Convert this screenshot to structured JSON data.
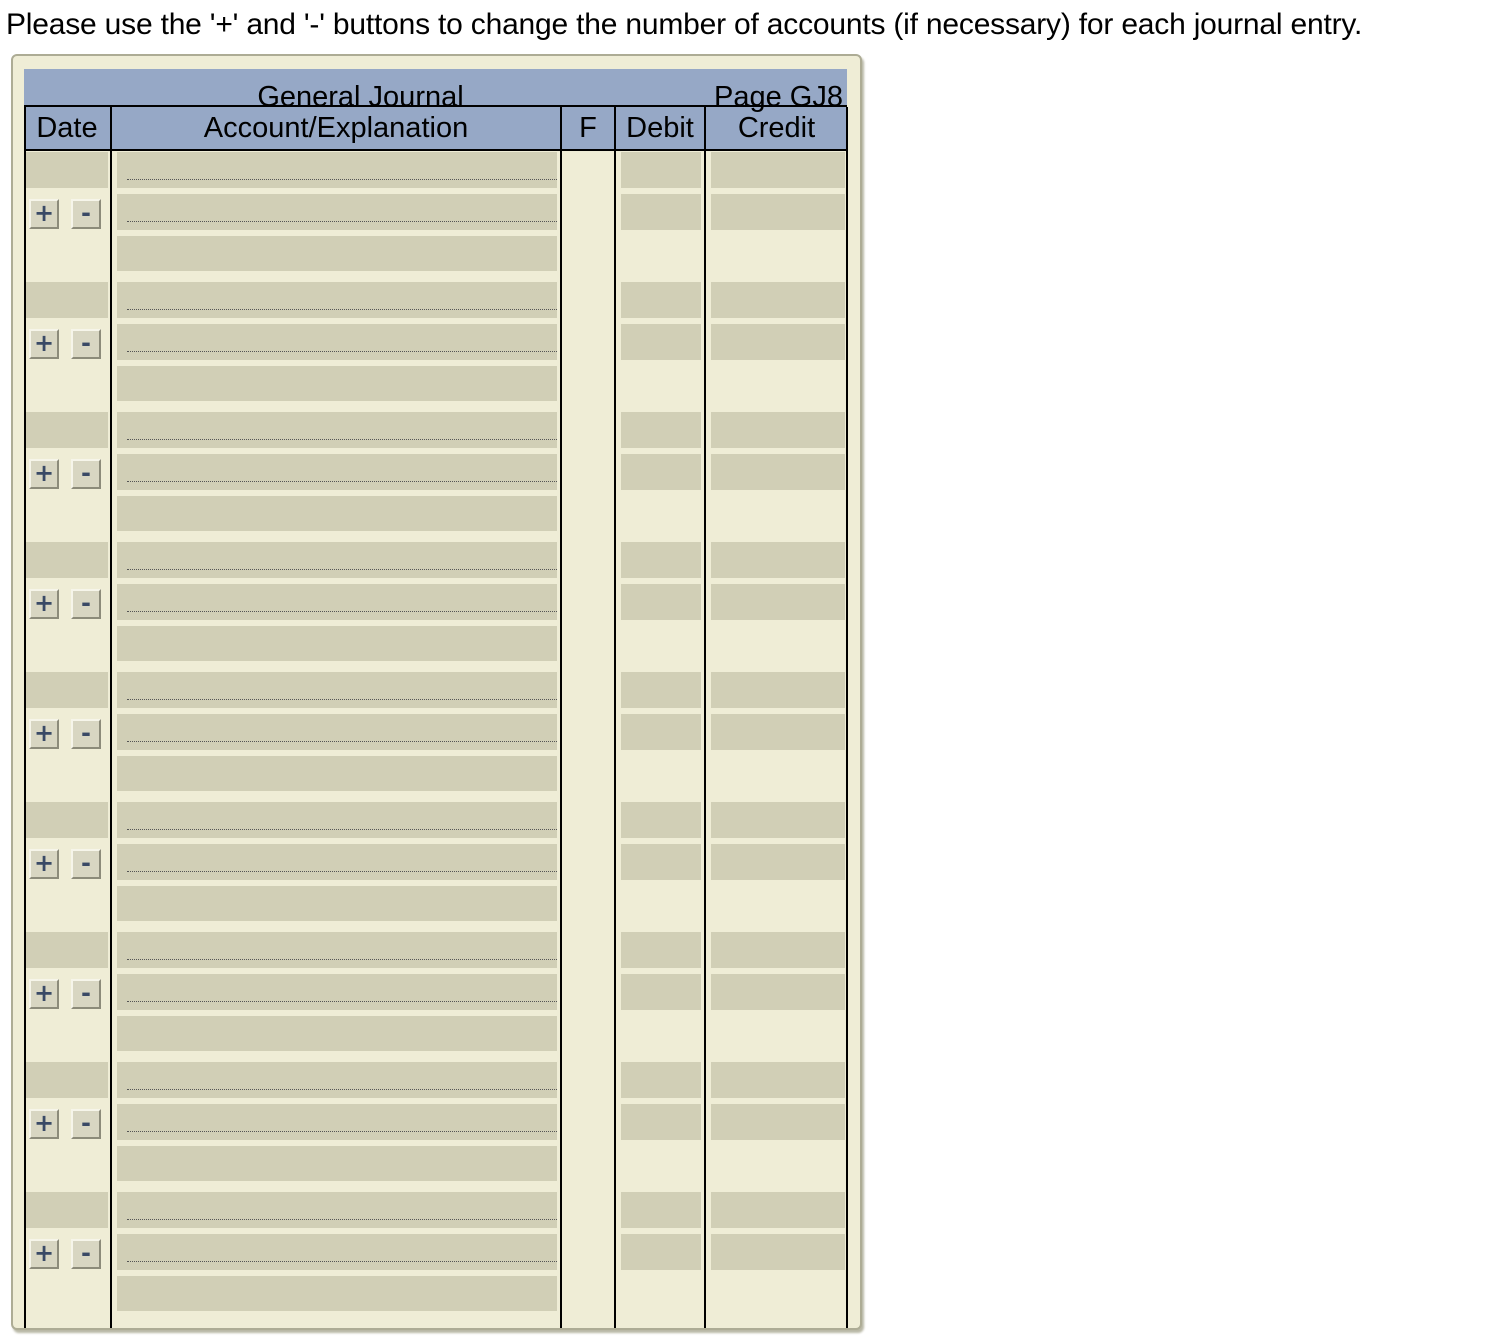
{
  "instructions": "Please use the '+' and '-' buttons to change the number of accounts (if necessary) for each journal entry.",
  "journal": {
    "title": "General Journal",
    "page_label": "Page GJ8",
    "columns": {
      "date": "Date",
      "account": "Account/Explanation",
      "folio": "F",
      "debit": "Debit",
      "credit": "Credit"
    },
    "add_button_label": "+",
    "remove_button_label": "-",
    "entries": [
      {
        "lines": 2,
        "date": "",
        "accounts": [
          "",
          ""
        ],
        "explanation": "",
        "debits": [
          "",
          ""
        ],
        "credits": [
          "",
          ""
        ]
      },
      {
        "lines": 2,
        "date": "",
        "accounts": [
          "",
          ""
        ],
        "explanation": "",
        "debits": [
          "",
          ""
        ],
        "credits": [
          "",
          ""
        ]
      },
      {
        "lines": 2,
        "date": "",
        "accounts": [
          "",
          ""
        ],
        "explanation": "",
        "debits": [
          "",
          ""
        ],
        "credits": [
          "",
          ""
        ]
      },
      {
        "lines": 2,
        "date": "",
        "accounts": [
          "",
          ""
        ],
        "explanation": "",
        "debits": [
          "",
          ""
        ],
        "credits": [
          "",
          ""
        ]
      },
      {
        "lines": 2,
        "date": "",
        "accounts": [
          "",
          ""
        ],
        "explanation": "",
        "debits": [
          "",
          ""
        ],
        "credits": [
          "",
          ""
        ]
      },
      {
        "lines": 2,
        "date": "",
        "accounts": [
          "",
          ""
        ],
        "explanation": "",
        "debits": [
          "",
          ""
        ],
        "credits": [
          "",
          ""
        ]
      },
      {
        "lines": 2,
        "date": "",
        "accounts": [
          "",
          ""
        ],
        "explanation": "",
        "debits": [
          "",
          ""
        ],
        "credits": [
          "",
          ""
        ]
      },
      {
        "lines": 2,
        "date": "",
        "accounts": [
          "",
          ""
        ],
        "explanation": "",
        "debits": [
          "",
          ""
        ],
        "credits": [
          "",
          ""
        ]
      },
      {
        "lines": 2,
        "date": "",
        "accounts": [
          "",
          ""
        ],
        "explanation": "",
        "debits": [
          "",
          ""
        ],
        "credits": [
          "",
          ""
        ]
      }
    ]
  }
}
